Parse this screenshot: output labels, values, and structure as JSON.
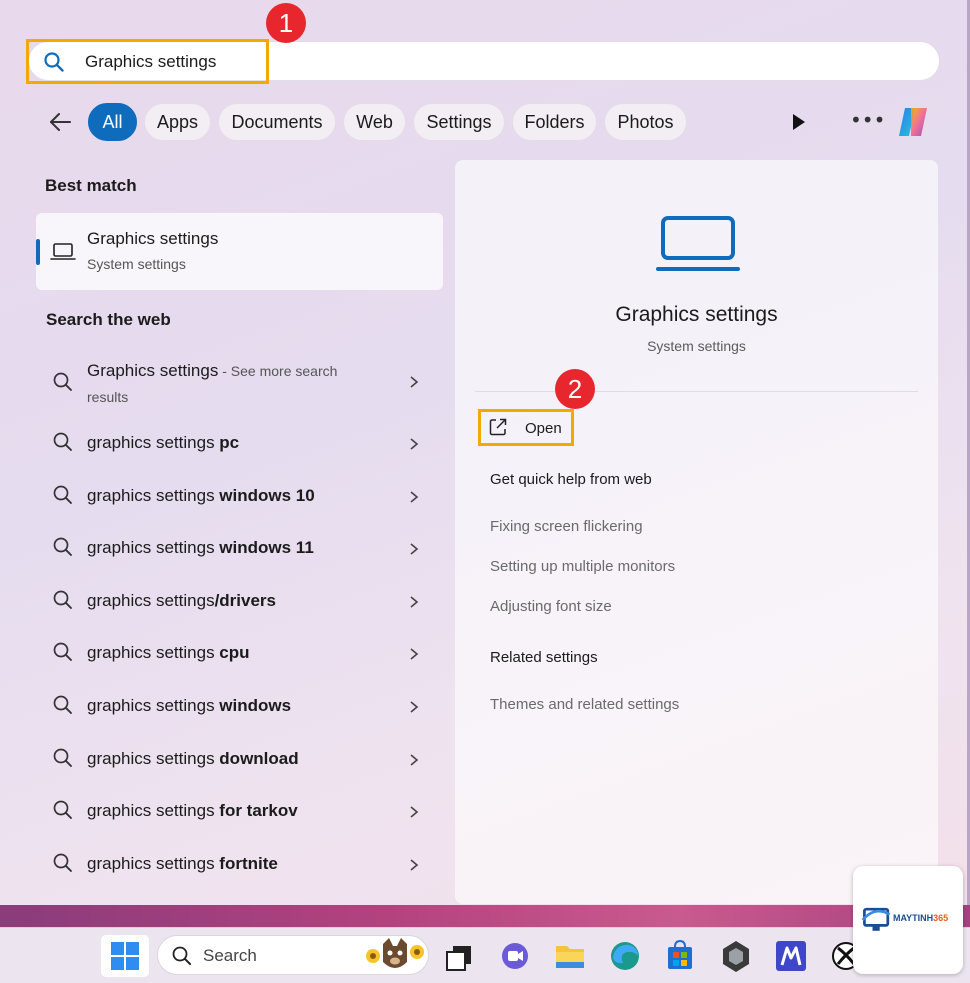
{
  "search": {
    "query": "Graphics settings"
  },
  "badges": [
    "1",
    "2"
  ],
  "filters": [
    {
      "label": "All",
      "active": true
    },
    {
      "label": "Apps"
    },
    {
      "label": "Documents"
    },
    {
      "label": "Web"
    },
    {
      "label": "Settings"
    },
    {
      "label": "Folders"
    },
    {
      "label": "Photos"
    }
  ],
  "icons": {
    "back": "arrow-left-icon",
    "play": "play-icon",
    "more": "more-icon",
    "copilot": "copilot-icon"
  },
  "best_match": {
    "heading": "Best match",
    "title": "Graphics settings",
    "subtitle": "System settings"
  },
  "search_web": {
    "heading": "Search the web",
    "first": {
      "text": "Graphics settings",
      "hint": " - See more search",
      "hint2": "results"
    },
    "items": [
      {
        "prefix": "graphics settings ",
        "bold": "pc"
      },
      {
        "prefix": "graphics settings ",
        "bold": "windows 10"
      },
      {
        "prefix": "graphics settings ",
        "bold": "windows 11"
      },
      {
        "prefix": "graphics settings",
        "bold": "/drivers"
      },
      {
        "prefix": "graphics settings ",
        "bold": "cpu"
      },
      {
        "prefix": "graphics settings ",
        "bold": "windows"
      },
      {
        "prefix": "graphics settings ",
        "bold": "download"
      },
      {
        "prefix": "graphics settings ",
        "bold": "for tarkov"
      },
      {
        "prefix": "graphics settings ",
        "bold": "fortnite"
      }
    ]
  },
  "detail": {
    "title": "Graphics settings",
    "subtitle": "System settings",
    "open_label": "Open",
    "quick_help_heading": "Get quick help from web",
    "quick_help_links": [
      "Fixing screen flickering",
      "Setting up multiple monitors",
      "Adjusting font size"
    ],
    "related_heading": "Related settings",
    "related_links": [
      "Themes and related settings"
    ]
  },
  "taskbar": {
    "search_label": "Search"
  },
  "watermark": {
    "brand_a": "MAYTINH",
    "brand_b": "365"
  },
  "colors": {
    "accent": "#0f6cbd",
    "highlight": "#f2a900",
    "badge": "#e8262d"
  }
}
